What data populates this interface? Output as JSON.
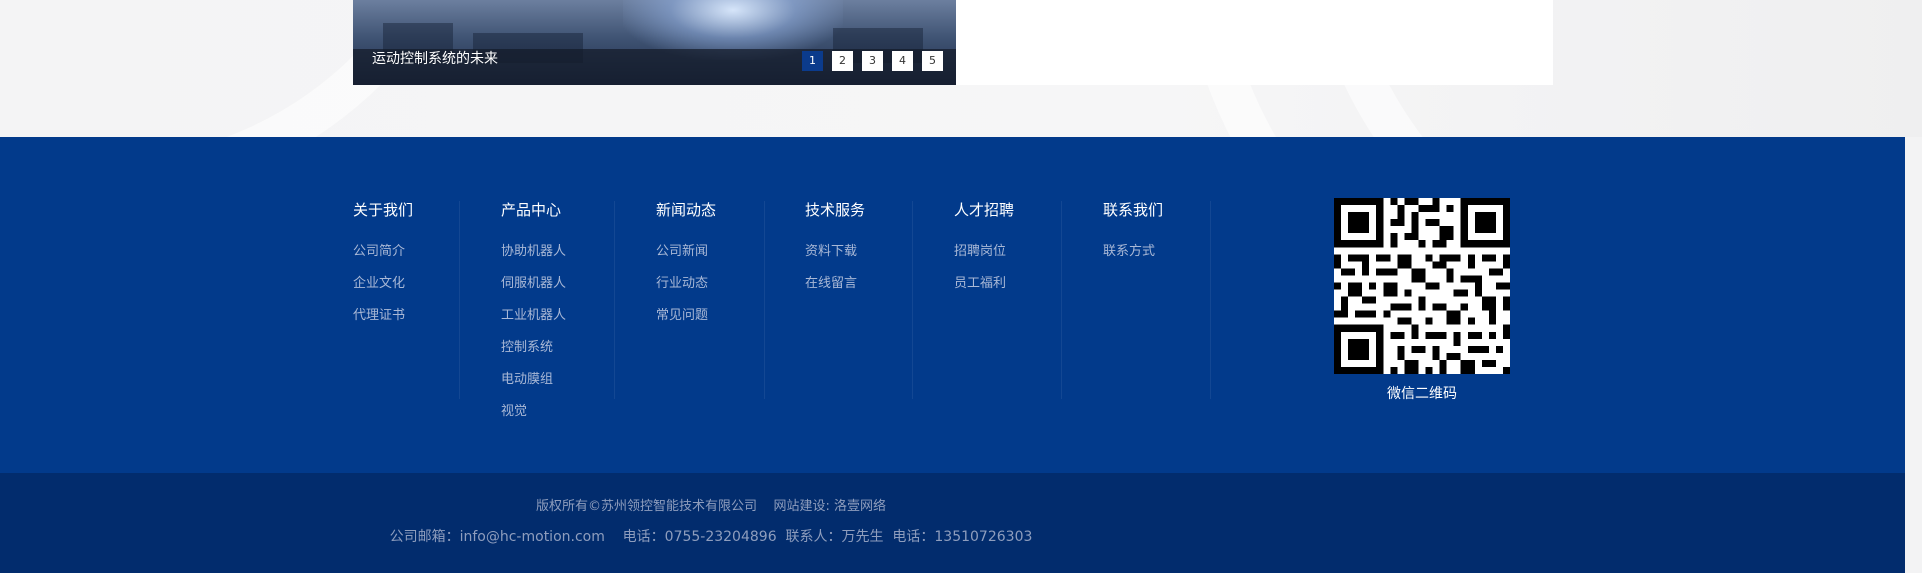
{
  "slider": {
    "caption": "运动控制系统的未来",
    "pages": [
      "1",
      "2",
      "3",
      "4",
      "5"
    ],
    "active_page": "1"
  },
  "footer_nav": [
    {
      "title": "关于我们",
      "links": [
        "公司简介",
        "企业文化",
        "代理证书"
      ]
    },
    {
      "title": "产品中心",
      "links": [
        "协助机器人",
        "伺服机器人",
        "工业机器人",
        "控制系统",
        "电动膜组",
        "视觉"
      ]
    },
    {
      "title": "新闻动态",
      "links": [
        "公司新闻",
        "行业动态",
        "常见问题"
      ]
    },
    {
      "title": "技术服务",
      "links": [
        "资料下载",
        "在线留言"
      ]
    },
    {
      "title": "人才招聘",
      "links": [
        "招聘岗位",
        "员工福利"
      ]
    },
    {
      "title": "联系我们",
      "links": [
        "联系方式"
      ]
    }
  ],
  "qr": {
    "label": "微信二维码"
  },
  "bottom": {
    "copyright": "版权所有©苏州领控智能技术有限公司    网站建设: 洛壹网络",
    "contact": "公司邮箱：info@hc-motion.com    电话：0755-23204896  联系人：万先生  电话：13510726303"
  },
  "colors": {
    "footer_bg": "#023a8b",
    "bottom_bar_bg": "#022c6d",
    "active_dot": "#0b3b8c",
    "link_text": "#a9b8d6"
  },
  "icons": [
    "qr-code-icon"
  ]
}
